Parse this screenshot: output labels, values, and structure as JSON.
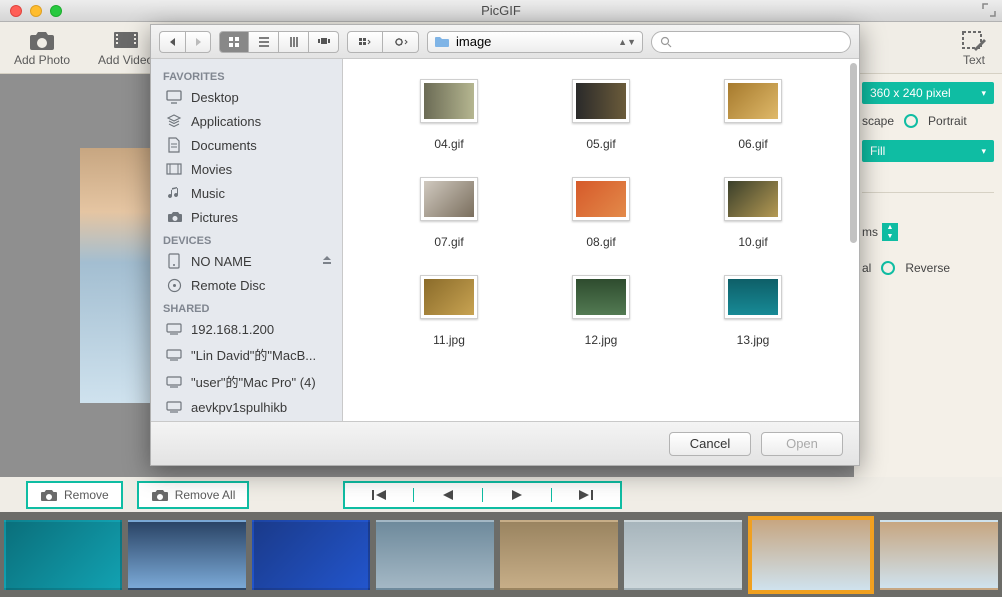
{
  "window": {
    "title": "PicGIF"
  },
  "toolbar": {
    "add_photo": "Add Photo",
    "add_video": "Add Video",
    "text": "Text"
  },
  "right_panel": {
    "size_label": "360 x 240 pixel",
    "landscape": "scape",
    "portrait": "Portrait",
    "fill_label": "Fill",
    "ms_suffix": "ms",
    "normal": "al",
    "reverse": "Reverse"
  },
  "bottom_bar": {
    "remove": "Remove",
    "remove_all": "Remove All"
  },
  "file_dialog": {
    "path_label": "image",
    "sidebar": {
      "favorites_header": "FAVORITES",
      "favorites": [
        {
          "label": "Desktop",
          "icon": "desktop"
        },
        {
          "label": "Applications",
          "icon": "apps"
        },
        {
          "label": "Documents",
          "icon": "doc"
        },
        {
          "label": "Movies",
          "icon": "movie"
        },
        {
          "label": "Music",
          "icon": "music"
        },
        {
          "label": "Pictures",
          "icon": "pic"
        }
      ],
      "devices_header": "DEVICES",
      "devices": [
        {
          "label": "NO NAME",
          "icon": "disk",
          "eject": true
        },
        {
          "label": "Remote Disc",
          "icon": "disc"
        }
      ],
      "shared_header": "SHARED",
      "shared": [
        {
          "label": "192.168.1.200",
          "icon": "host"
        },
        {
          "label": "\"Lin David\"的\"MacB...",
          "icon": "host"
        },
        {
          "label": "\"user\"的\"Mac Pro\" (4)",
          "icon": "host"
        },
        {
          "label": "aevkpv1spulhikb",
          "icon": "host"
        }
      ]
    },
    "files": [
      {
        "name": "04.gif",
        "bg": "linear-gradient(90deg,#6b6b55,#b5b690)"
      },
      {
        "name": "05.gif",
        "bg": "linear-gradient(90deg,#2a2a2a,#6b5b3a)"
      },
      {
        "name": "06.gif",
        "bg": "linear-gradient(135deg,#a67a2d,#dfb96a)"
      },
      {
        "name": "07.gif",
        "bg": "linear-gradient(135deg,#d0c9bf,#7a6e5d)"
      },
      {
        "name": "08.gif",
        "bg": "linear-gradient(135deg,#d65a2a,#e38a4a)"
      },
      {
        "name": "10.gif",
        "bg": "linear-gradient(135deg,#3a3f2a,#b59a54)"
      },
      {
        "name": "11.jpg",
        "bg": "linear-gradient(135deg,#8a6b2a,#c8a352)"
      },
      {
        "name": "12.jpg",
        "bg": "linear-gradient(180deg,#2e4c2e,#527a52)"
      },
      {
        "name": "13.jpg",
        "bg": "linear-gradient(180deg,#0e5f68,#178a96)"
      }
    ],
    "buttons": {
      "cancel": "Cancel",
      "open": "Open"
    }
  },
  "thumbs": [
    {
      "bg": "linear-gradient(135deg,#0a6f7b,#12a1b1)"
    },
    {
      "bg": "linear-gradient(180deg,#2a4466,#7ba9d6)"
    },
    {
      "bg": "linear-gradient(135deg,#1a3a8a,#2255cc)"
    },
    {
      "bg": "linear-gradient(180deg,#6e8a9c,#a4b8c5)"
    },
    {
      "bg": "linear-gradient(180deg,#9a8460,#c7ae88)"
    },
    {
      "bg": "linear-gradient(180deg,#a7b5bc,#cdd7db)"
    },
    {
      "bg": "linear-gradient(180deg,#c7a681,#cfe2ee)",
      "selected": true
    },
    {
      "bg": "linear-gradient(180deg,#c7a681,#cfe2ee)"
    }
  ]
}
